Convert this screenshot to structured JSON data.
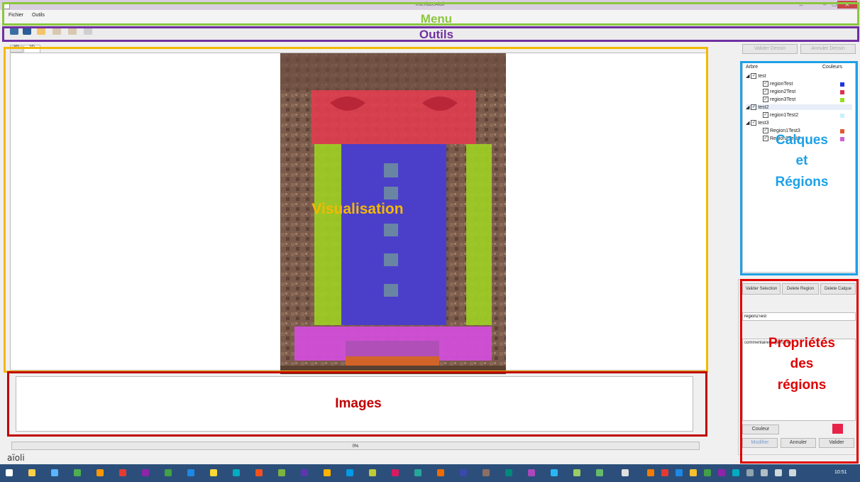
{
  "window": {
    "title": "InterfaceAioli"
  },
  "menu": {
    "items": [
      "Fichier",
      "Outils"
    ]
  },
  "tabs": [
    "3D",
    "2D"
  ],
  "drawing_buttons": {
    "validate": "Valider Dessin",
    "cancel": "Annuler Dessin"
  },
  "tree": {
    "col_tree": "Arbre",
    "col_colors": "Couleurs",
    "layers": [
      {
        "name": "test",
        "regions": [
          {
            "name": "regionTest",
            "color": "#2233dd"
          },
          {
            "name": "region2Test",
            "color": "#e03050"
          },
          {
            "name": "region3Test",
            "color": "#99dd22"
          }
        ]
      },
      {
        "name": "test2",
        "regions": [
          {
            "name": "region1Test2",
            "color": "#c8f0ff"
          }
        ]
      },
      {
        "name": "test3",
        "regions": [
          {
            "name": "Region1Test3",
            "color": "#e05a30"
          },
          {
            "name": "Region2Test3",
            "color": "#d060d0"
          }
        ]
      }
    ]
  },
  "region_actions": {
    "validate_selection": "Valider Selection",
    "delete_region": "Delete Region",
    "delete_layer": "Delete Calque"
  },
  "region_props": {
    "name_value": "region2Test",
    "comment_value": "commentaireRegion2Test",
    "color_button": "Couleur",
    "color_value": "#e8234a",
    "modify": "Modifier",
    "cancel": "Annuler",
    "validate": "Valider"
  },
  "progress": {
    "label": "0%",
    "value": 0
  },
  "logo": "aïoli",
  "clock": "10:51",
  "annotations": {
    "menu": "Menu",
    "tools": "Outils",
    "visualisation": "Visualisation",
    "images": "Images",
    "layers_regions": [
      "Calques",
      "et",
      "Régions"
    ],
    "region_properties": [
      "Propriétés",
      "des",
      "régions"
    ]
  },
  "colors": {
    "menu_annotation": "#8cc63f",
    "tools_annotation": "#7030a0",
    "visualisation_annotation": "#f5b800",
    "images_annotation": "#c00000",
    "layers_annotation": "#1da1e6",
    "props_annotation": "#e00000"
  }
}
